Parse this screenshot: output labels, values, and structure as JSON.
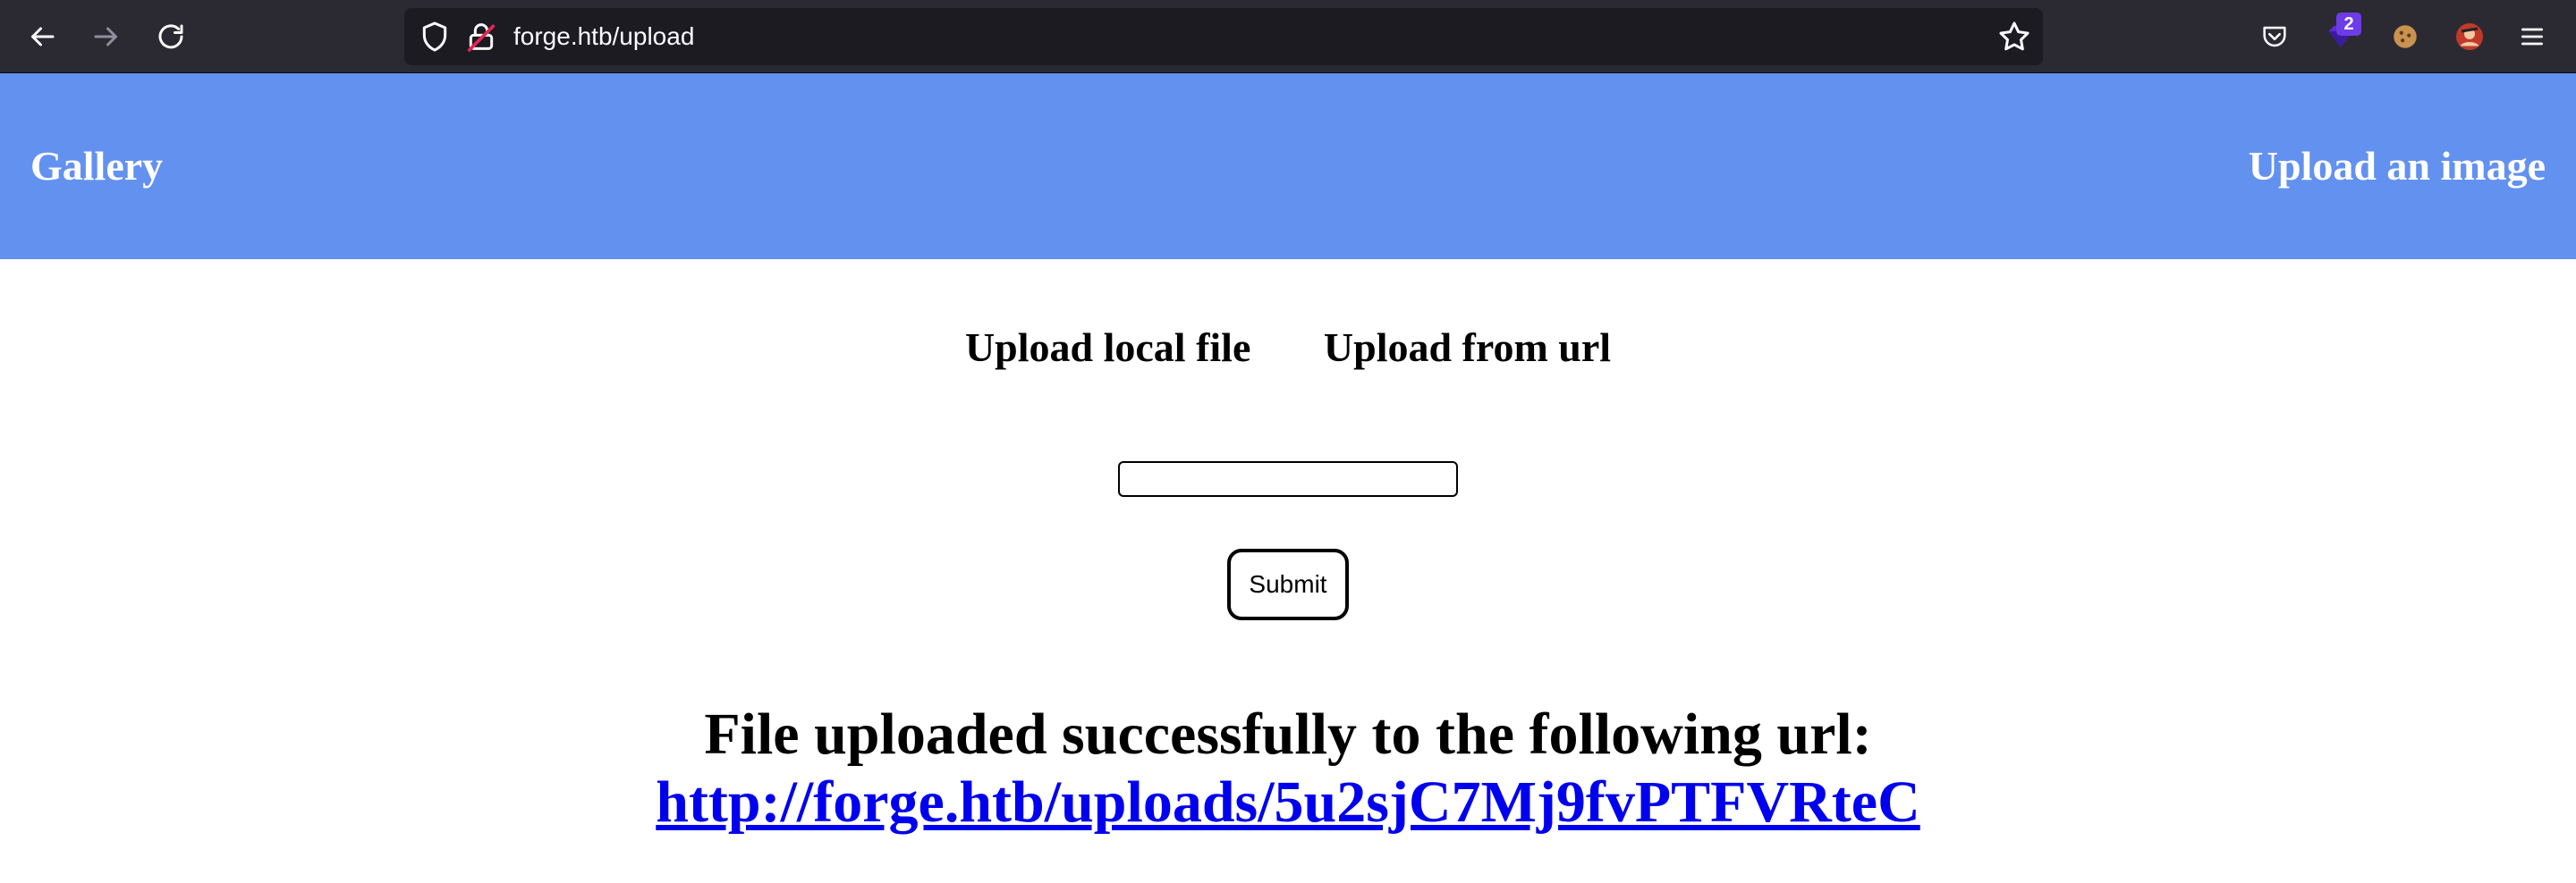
{
  "browser": {
    "url": "forge.htb/upload",
    "extension_badge": "2",
    "icons": [
      "back-arrow-icon",
      "forward-arrow-icon",
      "reload-icon",
      "shield-icon",
      "insecure-lock-icon",
      "bookmark-star-icon",
      "pocket-icon",
      "extension-icon",
      "cookie-icon",
      "avatar-icon",
      "menu-icon"
    ]
  },
  "header": {
    "background": "#6391f0",
    "gallery_label": "Gallery",
    "upload_label": "Upload an image"
  },
  "main": {
    "tab_local": "Upload local file",
    "tab_url": "Upload from url",
    "url_input_value": "",
    "submit_label": "Submit",
    "result_message": "File uploaded successfully to the following url:",
    "result_link": "http://forge.htb/uploads/5u2sjC7Mj9fvPTFVRteC",
    "link_color": "#0000ee"
  }
}
